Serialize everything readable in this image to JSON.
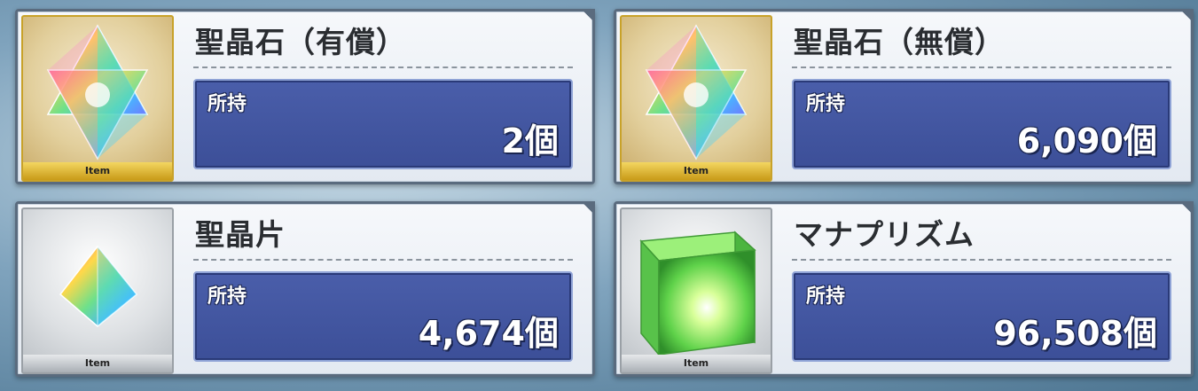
{
  "items": [
    {
      "name": "聖晶石（有償）",
      "own_label": "所持",
      "value": "2個",
      "tag": "Item",
      "frame": "gold",
      "icon": "saint-quartz-icon"
    },
    {
      "name": "聖晶石（無償）",
      "own_label": "所持",
      "value": "6,090個",
      "tag": "Item",
      "frame": "gold",
      "icon": "saint-quartz-icon"
    },
    {
      "name": "聖晶片",
      "own_label": "所持",
      "value": "4,674個",
      "tag": "Item",
      "frame": "silver",
      "icon": "quartz-fragment-icon"
    },
    {
      "name": "マナプリズム",
      "own_label": "所持",
      "value": "96,508個",
      "tag": "Item",
      "frame": "silver",
      "icon": "mana-prism-icon"
    }
  ]
}
